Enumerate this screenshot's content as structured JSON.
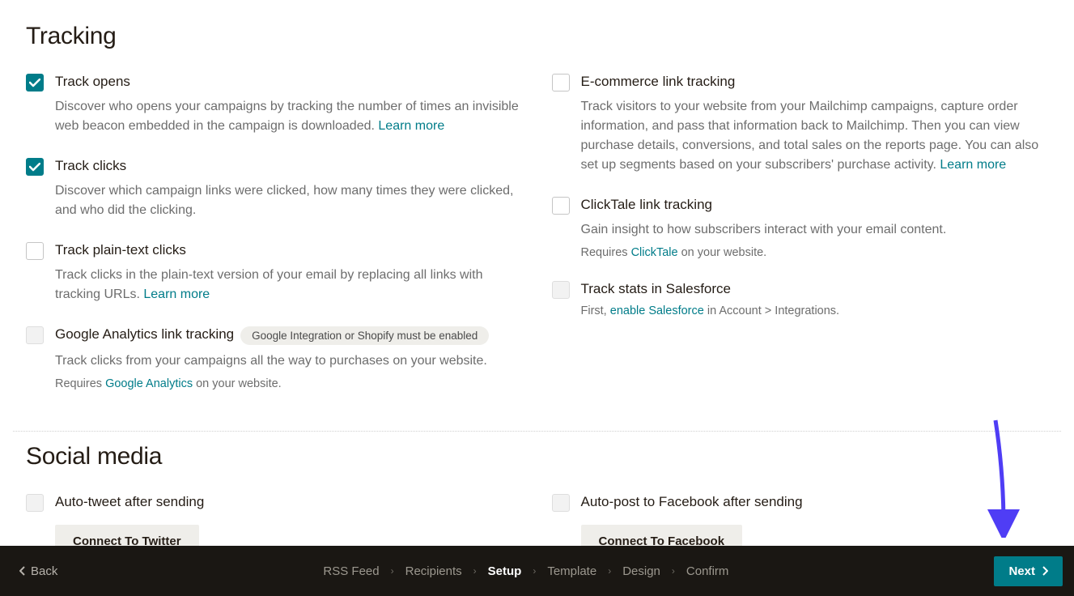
{
  "sections": {
    "tracking_title": "Tracking",
    "social_title": "Social media"
  },
  "tracking": {
    "left": [
      {
        "id": "track-opens",
        "title": "Track opens",
        "checked": true,
        "disabled": false,
        "desc": "Discover who opens your campaigns by tracking the number of times an invisible web beacon embedded in the campaign is downloaded. ",
        "link": "Learn more"
      },
      {
        "id": "track-clicks",
        "title": "Track clicks",
        "checked": true,
        "disabled": false,
        "desc": "Discover which campaign links were clicked, how many times they were clicked, and who did the clicking."
      },
      {
        "id": "track-plaintext",
        "title": "Track plain-text clicks",
        "checked": false,
        "disabled": false,
        "desc": "Track clicks in the plain-text version of your email by replacing all links with tracking URLs. ",
        "link": "Learn more"
      },
      {
        "id": "ga-tracking",
        "title": "Google Analytics link tracking",
        "checked": false,
        "disabled": true,
        "badge": "Google Integration or Shopify must be enabled",
        "desc": "Track clicks from your campaigns all the way to purchases on your website.",
        "sub_pre": "Requires ",
        "sub_link": "Google Analytics",
        "sub_post": " on your website."
      }
    ],
    "right": [
      {
        "id": "ecommerce-tracking",
        "title": "E-commerce link tracking",
        "checked": false,
        "disabled": false,
        "desc": "Track visitors to your website from your Mailchimp campaigns, capture order information, and pass that information back to Mailchimp. Then you can view purchase details, conversions, and total sales on the reports page. You can also set up segments based on your subscribers' purchase activity. ",
        "link": "Learn more"
      },
      {
        "id": "clicktale-tracking",
        "title": "ClickTale link tracking",
        "checked": false,
        "disabled": false,
        "desc": "Gain insight to how subscribers interact with your email content.",
        "sub_pre": "Requires ",
        "sub_link": "ClickTale",
        "sub_post": " on your website."
      },
      {
        "id": "salesforce-tracking",
        "title": "Track stats in Salesforce",
        "checked": false,
        "disabled": true,
        "sub_pre": "First, ",
        "sub_link": "enable Salesforce",
        "sub_post": " in Account > Integrations."
      }
    ]
  },
  "social": {
    "twitter_label": "Auto-tweet after sending",
    "twitter_btn": "Connect To Twitter",
    "facebook_label": "Auto-post to Facebook after sending",
    "facebook_btn": "Connect To Facebook"
  },
  "footer": {
    "back": "Back",
    "steps": [
      "RSS Feed",
      "Recipients",
      "Setup",
      "Template",
      "Design",
      "Confirm"
    ],
    "active_step": "Setup",
    "next": "Next"
  }
}
